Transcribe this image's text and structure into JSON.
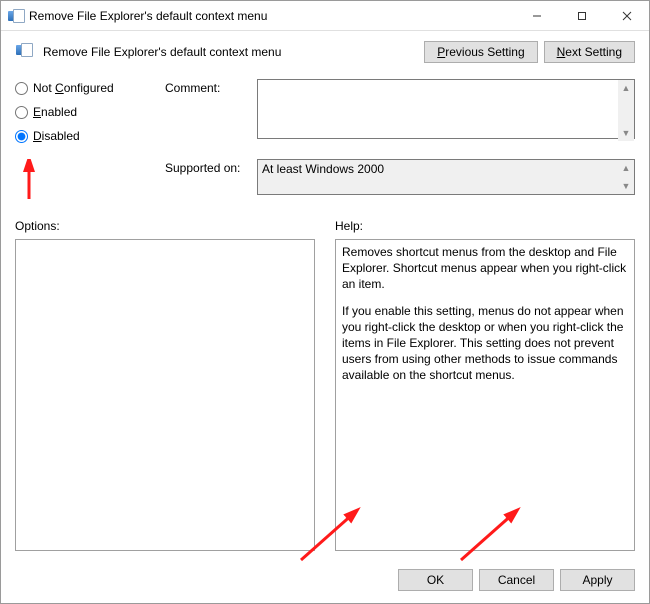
{
  "window": {
    "title": "Remove File Explorer's default context menu"
  },
  "subtitle": "Remove File Explorer's default context menu",
  "nav": {
    "previous": "Previous Setting",
    "next": "Next Setting"
  },
  "radios": {
    "not_configured": "Not Configured",
    "enabled": "Enabled",
    "disabled": "Disabled",
    "selected": "disabled"
  },
  "labels": {
    "comment": "Comment:",
    "supported_on": "Supported on:",
    "options": "Options:",
    "help": "Help:"
  },
  "comment_value": "",
  "supported_on_value": "At least Windows 2000",
  "options_content": "",
  "help_content": {
    "p1": "Removes shortcut menus from the desktop and File Explorer. Shortcut menus appear when you right-click an item.",
    "p2": "If you enable this setting, menus do not appear when you right-click the desktop or when you right-click the items in File Explorer. This setting does not prevent users from using other methods to issue commands available on the shortcut menus."
  },
  "buttons": {
    "ok": "OK",
    "cancel": "Cancel",
    "apply": "Apply"
  }
}
